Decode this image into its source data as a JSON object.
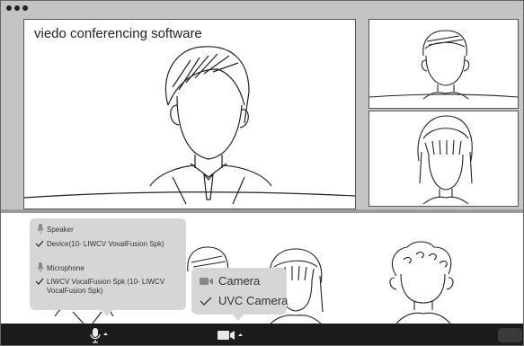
{
  "window": {
    "traffic_lights": [
      "close-dot",
      "minimize-dot",
      "maximize-dot"
    ]
  },
  "main_video": {
    "label": "viedo conferencing  software"
  },
  "audio_popover": {
    "speaker_heading": "Speaker",
    "speaker_device": "Device(10- LIWCV VovalFusion Spk)",
    "microphone_heading": "Microphone",
    "microphone_device_line1": "LIWCV VocalFusion Spk (10- LIWCV",
    "microphone_device_line2": "VocalFusion Spk)"
  },
  "camera_popover": {
    "heading": "Camera",
    "device": "UVC Camera"
  },
  "toolbar": {
    "mic_icon": "microphone-icon",
    "camera_icon": "video-camera-icon"
  },
  "colors": {
    "chrome": "#c4c4c4",
    "toolbar": "#1b1b1b",
    "popover": "#d6d6d6"
  }
}
